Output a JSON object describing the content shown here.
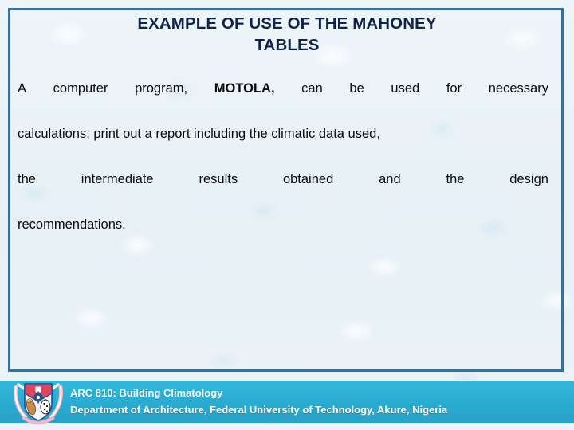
{
  "slide": {
    "background_color": "#e9f2f7",
    "border_color": "#3d6e96",
    "title": {
      "line1": "EXAMPLE OF USE OF THE MAHONEY",
      "line2": "TABLES",
      "color": "#10234c"
    },
    "body": {
      "color": "#0a0a0a",
      "line1": {
        "segments": [
          "A",
          "computer",
          "program,",
          "MOTOLA,",
          "can",
          "be",
          "used",
          "for",
          "necessary"
        ],
        "bold_segment_index": 3
      },
      "line2": {
        "text": "calculations, print out a report including the climatic data used,"
      },
      "line3": {
        "segments": [
          "the",
          "intermediate",
          "results",
          "obtained",
          "and",
          "the",
          "design"
        ]
      },
      "line4": {
        "text": "recommendations."
      },
      "full_text": "A computer program, MOTOLA, can be used for necessary calculations, print out a report including the climatic data used, the intermediate results obtained and the design recommendations."
    },
    "footer": {
      "background_color": "#2cb2d6",
      "text_color": "#ffffff",
      "line1": "ARC 810: Building Climatology",
      "line2": "Department of Architecture, Federal University of Technology, Akure, Nigeria",
      "logo": {
        "name": "futa-coat-of-arms",
        "shield_top_color": "#e0475f",
        "shield_bottom_color": "#f2f6fa",
        "tusk_color": "#f0a7bd",
        "accent_color": "#1f4f8f"
      }
    }
  }
}
